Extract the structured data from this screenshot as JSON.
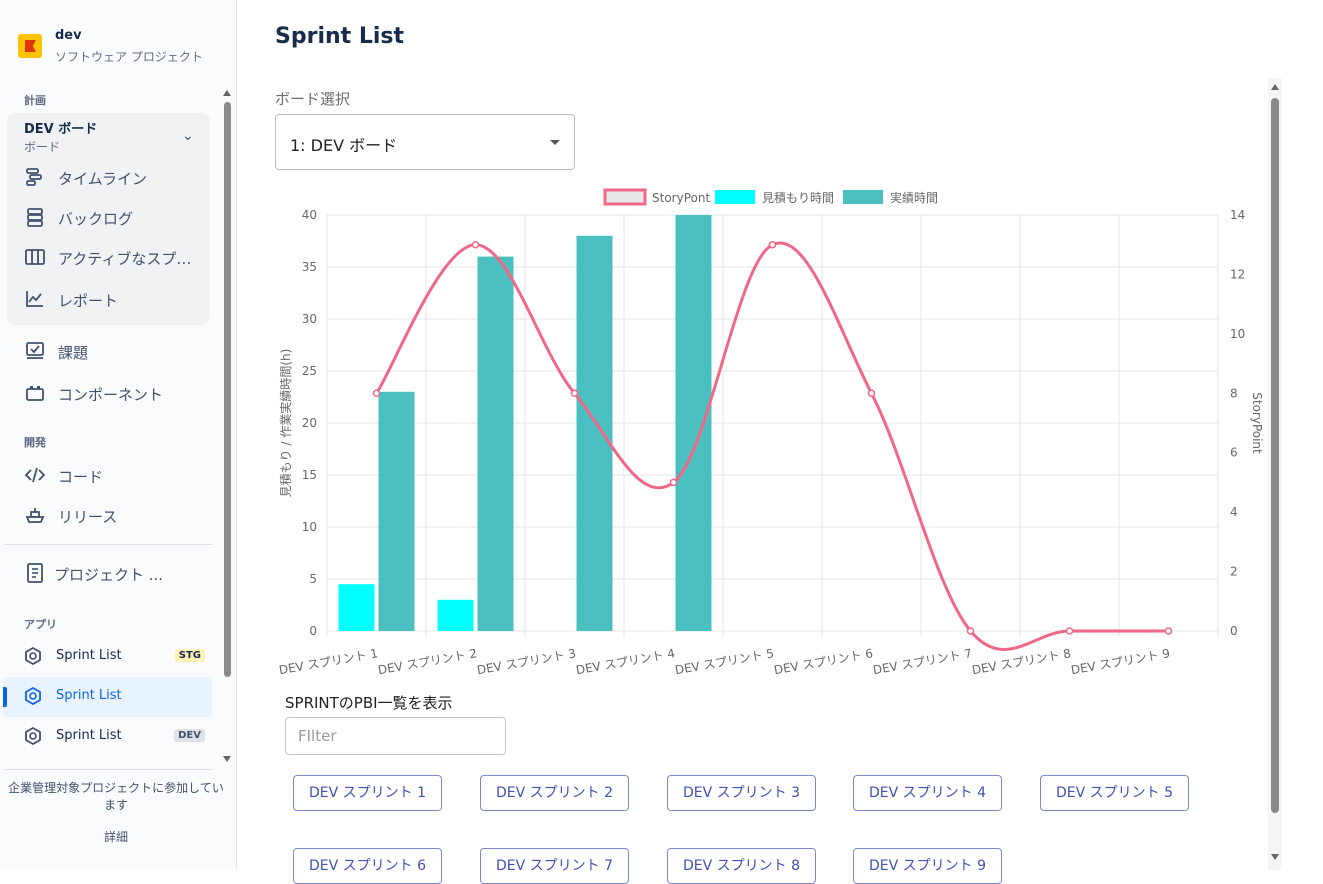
{
  "sidebar": {
    "project": {
      "name": "dev",
      "type": "ソフトウェア プロジェクト"
    },
    "sections": {
      "plan": "計画",
      "dev": "開発",
      "apps": "アプリ"
    },
    "board": {
      "title": "DEV ボード",
      "subtitle": "ボード"
    },
    "plan_items": [
      {
        "label": "タイムライン",
        "icon": "timeline-icon"
      },
      {
        "label": "バックログ",
        "icon": "backlog-icon"
      },
      {
        "label": "アクティブなスプリント",
        "icon": "board-icon"
      },
      {
        "label": "レポート",
        "icon": "reports-icon"
      }
    ],
    "other_items": [
      {
        "label": "課題",
        "icon": "issues-icon"
      },
      {
        "label": "コンポーネント",
        "icon": "components-icon"
      }
    ],
    "dev_items": [
      {
        "label": "コード",
        "icon": "code-icon"
      },
      {
        "label": "リリース",
        "icon": "release-icon"
      }
    ],
    "project_page": {
      "label": "プロジェクト ...",
      "icon": "page-icon"
    },
    "apps": [
      {
        "label": "Sprint List",
        "badge": "STG",
        "badge_color": "#fff0b3",
        "badge_text": "#172b4d"
      },
      {
        "label": "Sprint List",
        "badge": "",
        "active": true
      },
      {
        "label": "Sprint List",
        "badge": "DEV",
        "badge_color": "#dfe1e6",
        "badge_text": "#42526e"
      }
    ],
    "footer": {
      "text": "企業管理対象プロジェクトに参加しています",
      "link": "詳細"
    }
  },
  "main": {
    "title": "Sprint List",
    "board_select": {
      "label": "ボード選択",
      "value": "1: DEV ボード"
    },
    "pbi_label": "SPRINTのPBI一覧を表示",
    "filter_placeholder": "FIlter",
    "sprint_buttons": [
      "DEV スプリント 1",
      "DEV スプリント 2",
      "DEV スプリント 3",
      "DEV スプリント 4",
      "DEV スプリント 5",
      "DEV スプリント 6",
      "DEV スプリント 7",
      "DEV スプリント 8",
      "DEV スプリント 9"
    ]
  },
  "chart_data": {
    "type": "bar",
    "categories": [
      "DEV スプリント 1",
      "DEV スプリント 2",
      "DEV スプリント 3",
      "DEV スプリント 4",
      "DEV スプリント 5",
      "DEV スプリント 6",
      "DEV スプリント 7",
      "DEV スプリント 8",
      "DEV スプリント 9"
    ],
    "series": [
      {
        "name": "StoryPont",
        "type": "line",
        "axis": "right",
        "color": "#f06787",
        "values": [
          8,
          13,
          8,
          5,
          13,
          8,
          0,
          0,
          0
        ]
      },
      {
        "name": "見積もり時間",
        "type": "bar",
        "axis": "left",
        "color": "#00ffff",
        "values": [
          4.5,
          3,
          0,
          0,
          0,
          0,
          0,
          0,
          0
        ]
      },
      {
        "name": "実績時間",
        "type": "bar",
        "axis": "left",
        "color": "#4bc0c0",
        "values": [
          23,
          36,
          38,
          40,
          0,
          0,
          0,
          0,
          0
        ]
      }
    ],
    "ylabel": "見積もり / 作業実績時間(h)",
    "y2label": "StoryPoint",
    "ylim": [
      0,
      40
    ],
    "y2lim": [
      0,
      14
    ],
    "yticks": [
      0,
      5,
      10,
      15,
      20,
      25,
      30,
      35,
      40
    ],
    "y2ticks": [
      0,
      2,
      4,
      6,
      8,
      10,
      12,
      14
    ],
    "legend": "top",
    "grid": true
  }
}
